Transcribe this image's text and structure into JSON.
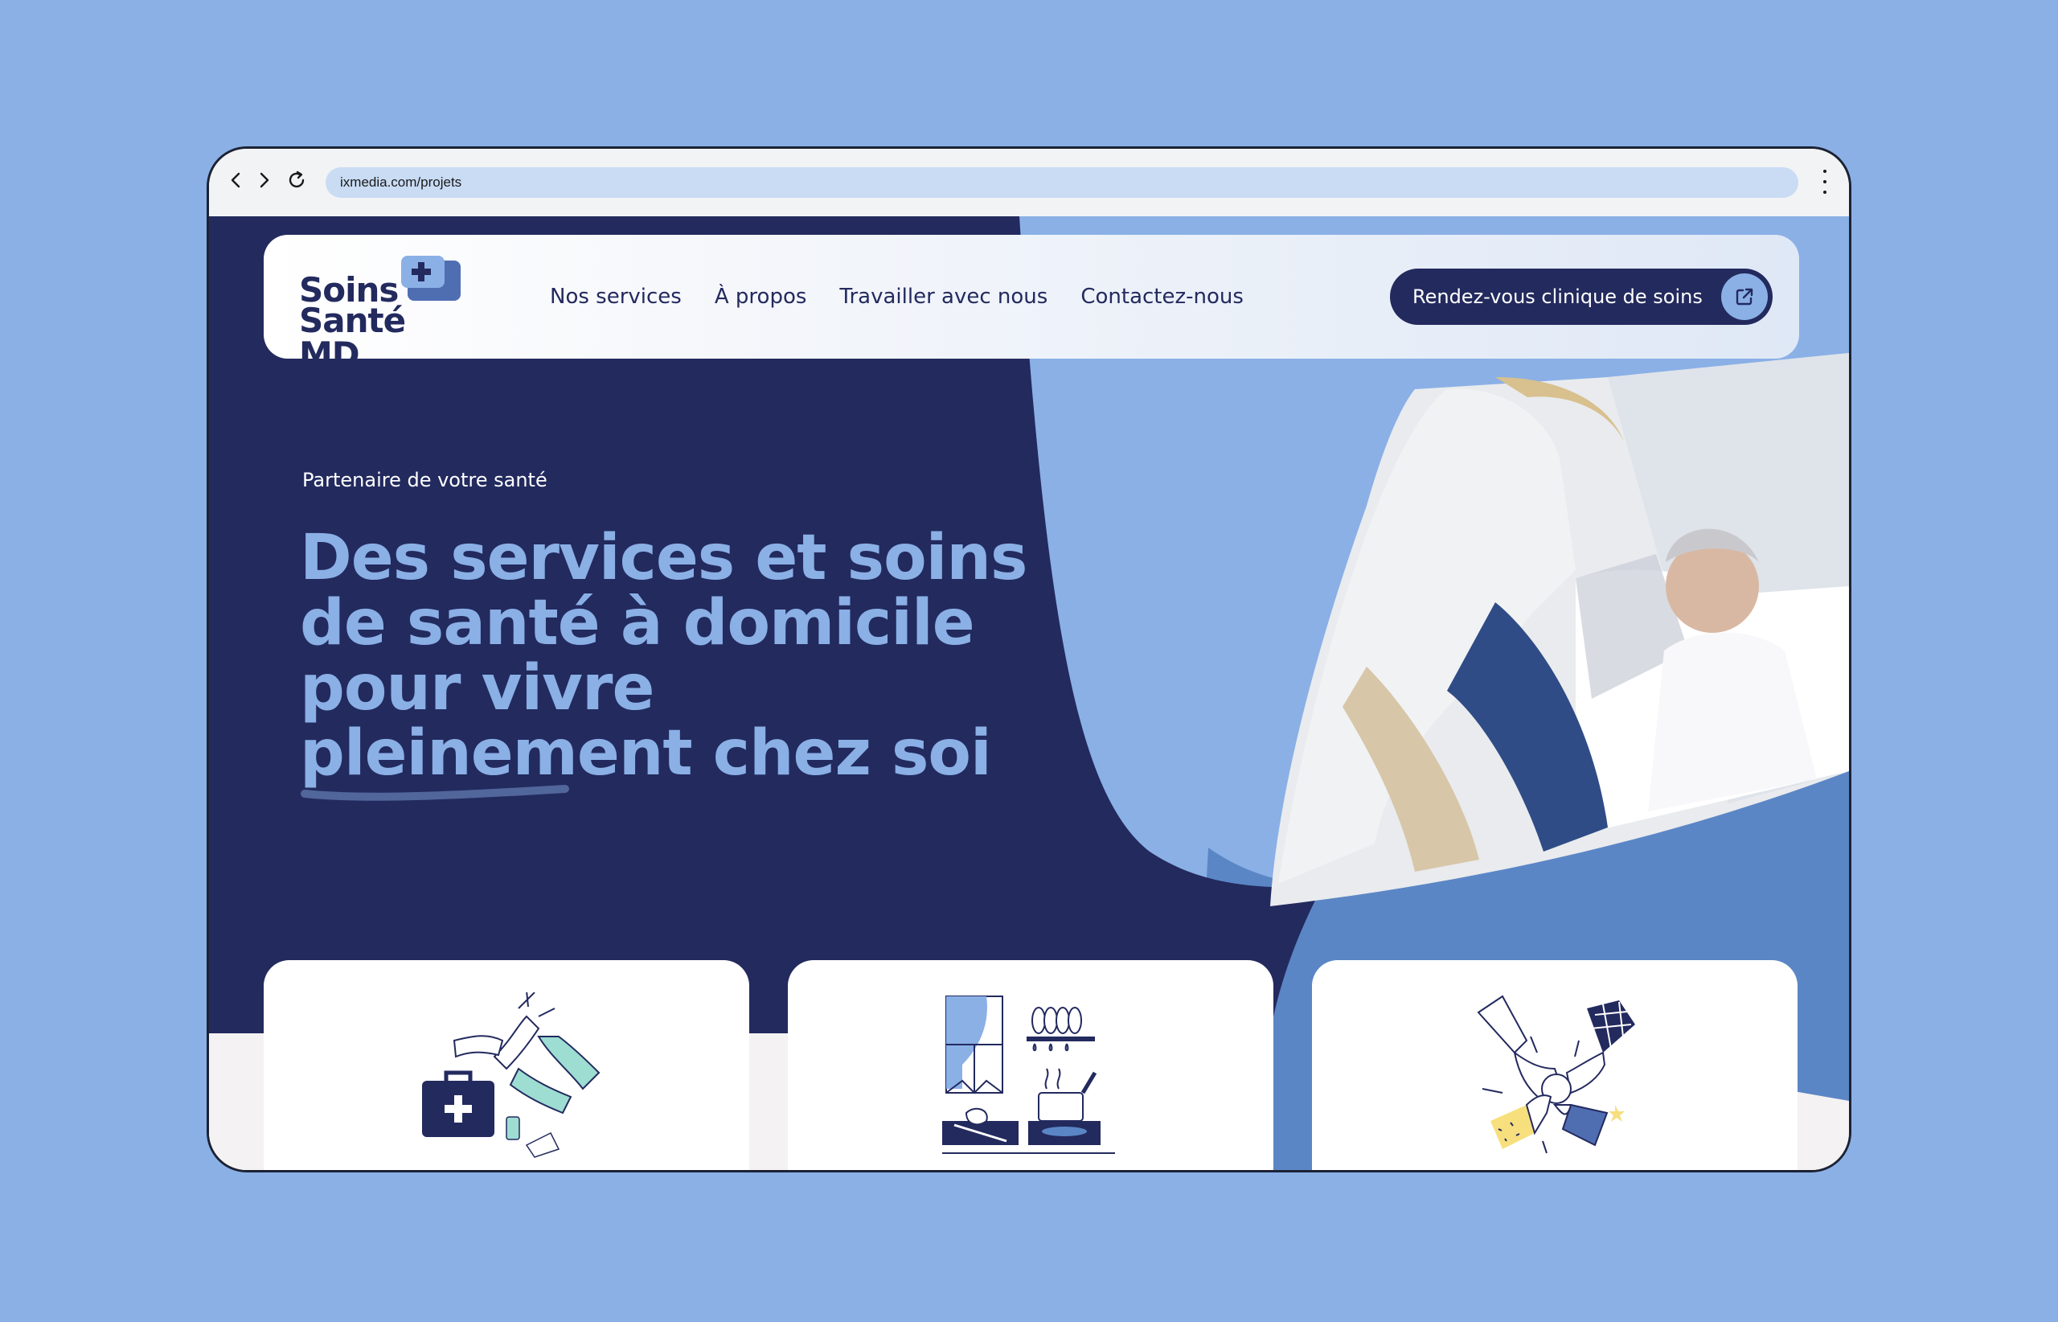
{
  "browser": {
    "url": "ixmedia.com/projets",
    "icons": [
      "back-icon",
      "forward-icon",
      "reload-icon",
      "more-vertical-icon"
    ]
  },
  "site": {
    "logo": {
      "line1": "Soins",
      "line2": "Santé MD"
    },
    "nav": [
      {
        "label": "Nos services"
      },
      {
        "label": "À propos"
      },
      {
        "label": "Travailler avec nous"
      },
      {
        "label": "Contactez-nous"
      }
    ],
    "cta": {
      "label": "Rendez-vous clinique de soins",
      "icon": "external-link-icon"
    },
    "hero": {
      "eyebrow": "Partenaire de votre santé",
      "headline": "Des services et soins de santé à domicile pour vivre pleinement chez soi"
    },
    "cards": [
      {
        "illustration": "medical-kit-high-five-illustration"
      },
      {
        "illustration": "kitchen-illustration"
      },
      {
        "illustration": "team-hands-illustration"
      }
    ]
  },
  "colors": {
    "page_background": "#8ab0e6",
    "navy": "#232a5e",
    "light_blue": "#8ab0e6",
    "mid_blue": "#5b86c6",
    "mint": "#9dddd2",
    "yellow": "#f7df7e"
  }
}
